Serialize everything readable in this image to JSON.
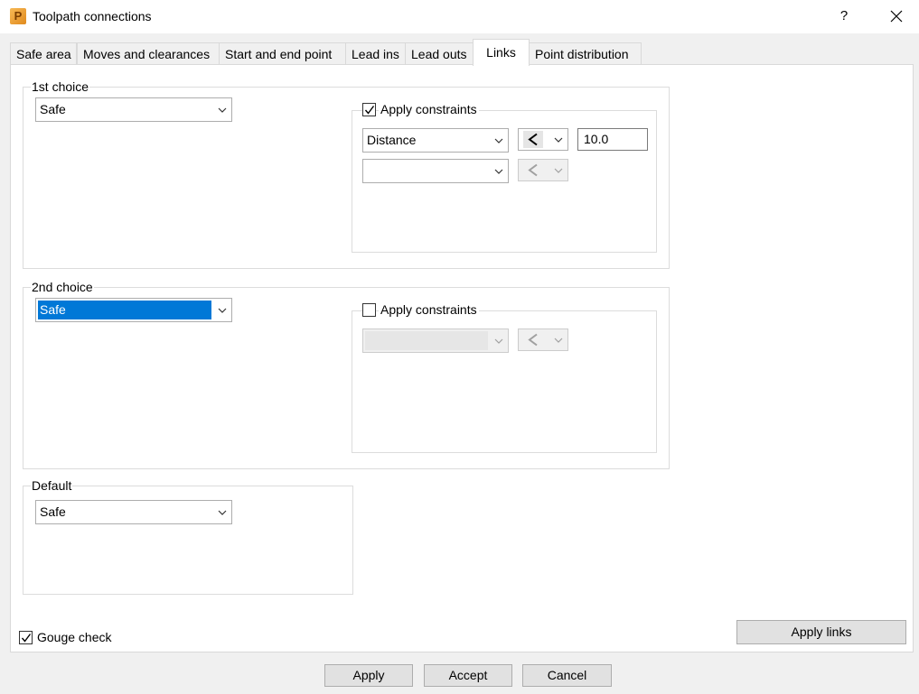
{
  "window": {
    "title": "Toolpath connections",
    "help_label": "?"
  },
  "tabs": [
    {
      "label": "Safe area"
    },
    {
      "label": "Moves and clearances"
    },
    {
      "label": "Start and end point"
    },
    {
      "label": "Lead ins"
    },
    {
      "label": "Lead outs"
    },
    {
      "label": "Links",
      "active": true
    },
    {
      "label": "Point distribution"
    }
  ],
  "first_choice": {
    "title": "1st choice",
    "move_type": "Safe",
    "apply_constraints": {
      "label": "Apply constraints",
      "checked": true
    },
    "constraint1": {
      "type": "Distance",
      "comparator": "<",
      "value": "10.0"
    },
    "constraint2": {
      "type": "",
      "comparator": "<"
    }
  },
  "second_choice": {
    "title": "2nd choice",
    "move_type": "Safe",
    "apply_constraints": {
      "label": "Apply constraints",
      "checked": false
    },
    "constraint1": {
      "type": "",
      "comparator": "<"
    }
  },
  "default": {
    "title": "Default",
    "move_type": "Safe"
  },
  "gouge_check": {
    "label": "Gouge check",
    "checked": true
  },
  "apply_links_label": "Apply links",
  "footer": {
    "apply_label": "Apply",
    "accept_label": "Accept",
    "cancel_label": "Cancel"
  },
  "colors": {
    "selection": "#0078d7",
    "panel": "#ffffff",
    "dialog": "#f0f0f0"
  }
}
